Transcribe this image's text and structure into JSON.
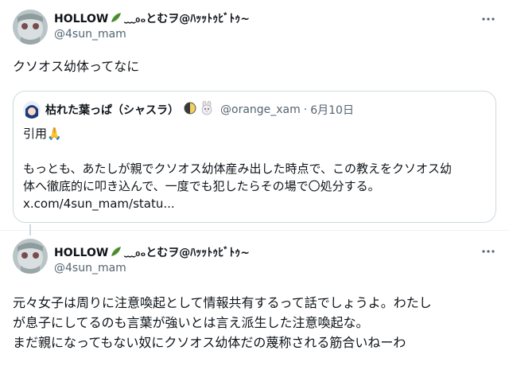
{
  "post1": {
    "display_name_prefix": "HOLLOW",
    "display_name_suffix": "﹏₀ₒとむヲ@ﾊｯｯﾄｩﾋﾞﾄｩ~",
    "handle": "@4sun_mam",
    "text": "クソオス幼体ってなに",
    "more_icon": "more-horizontal-icon"
  },
  "quote": {
    "display_name": "枯れた葉っぱ（シャスラ）",
    "handle": "@orange_xam",
    "separator": "·",
    "date": "6月10日",
    "line1": "引用🙏",
    "line2": "もっとも、あたしが親でクソオス幼体産み出した時点で、この教えをクソオス幼",
    "line3": "体へ徹底的に叩き込んで、一度でも犯したらその場で〇処分する。",
    "link": "x.com/4sun_mam/statu..."
  },
  "post2": {
    "display_name_prefix": "HOLLOW",
    "display_name_suffix": "﹏₀ₒとむヲ@ﾊｯｯﾄｩﾋﾞﾄｩ~",
    "handle": "@4sun_mam",
    "line1": "元々女子は周りに注意喚起として情報共有するって話でしょうよ。わたし",
    "line2": "が息子にしてるのも言葉が強いとは言え派生した注意喚起な。",
    "line3": "まだ親になってもない奴にクソオス幼体だの蔑称される筋合いねーわ",
    "more_icon": "more-horizontal-icon"
  },
  "colors": {
    "text": "#0f1419",
    "secondary": "#536471",
    "border": "#cfd9de",
    "leaf_green": "#5a9c3a"
  }
}
